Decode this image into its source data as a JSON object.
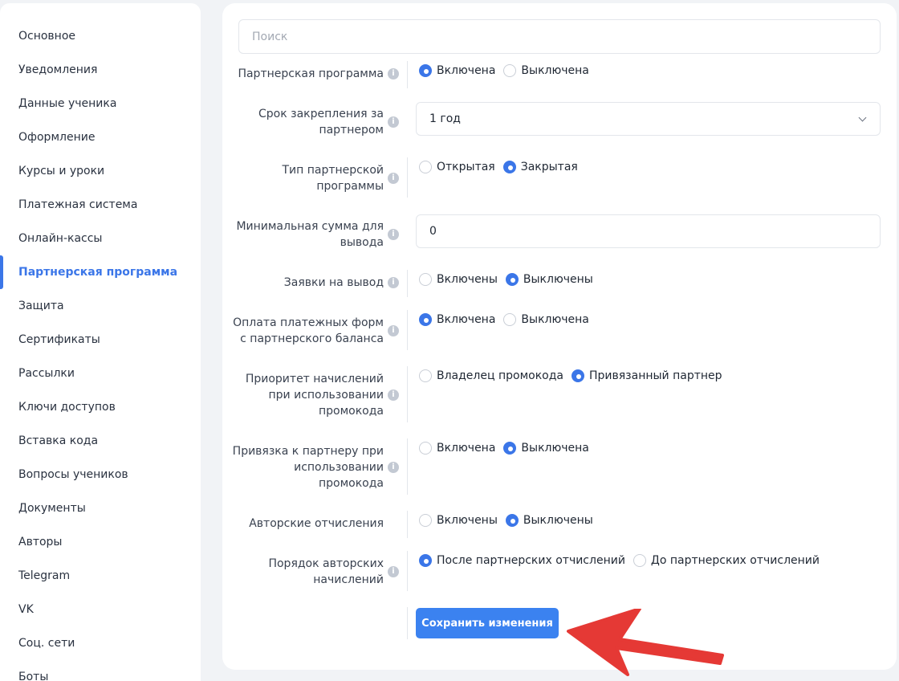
{
  "sidebar": {
    "items": [
      {
        "label": "Основное"
      },
      {
        "label": "Уведомления"
      },
      {
        "label": "Данные ученика"
      },
      {
        "label": "Оформление"
      },
      {
        "label": "Курсы и уроки"
      },
      {
        "label": "Платежная система"
      },
      {
        "label": "Онлайн-кассы"
      },
      {
        "label": "Партнерская программа"
      },
      {
        "label": "Защита"
      },
      {
        "label": "Сертификаты"
      },
      {
        "label": "Рассылки"
      },
      {
        "label": "Ключи доступов"
      },
      {
        "label": "Вставка кода"
      },
      {
        "label": "Вопросы учеников"
      },
      {
        "label": "Документы"
      },
      {
        "label": "Авторы"
      },
      {
        "label": "Telegram"
      },
      {
        "label": "VK"
      },
      {
        "label": "Соц. сети"
      },
      {
        "label": "Боты"
      }
    ],
    "active_item": "Партнерская программа"
  },
  "search": {
    "placeholder": "Поиск"
  },
  "settings": {
    "program": {
      "label": "Партнерская программа",
      "options": [
        "Включена",
        "Выключена"
      ],
      "selected": "Включена"
    },
    "term": {
      "label_line1": "Срок закрепления за",
      "label_line2": "партнером",
      "value": "1 год"
    },
    "type": {
      "label_line1": "Тип партнерской",
      "label_line2": "программы",
      "options": [
        "Открытая",
        "Закрытая"
      ],
      "selected": "Закрытая"
    },
    "min_sum": {
      "label_line1": "Минимальная сумма для",
      "label_line2": "вывода",
      "value": "0"
    },
    "withdraw": {
      "label": "Заявки на вывод",
      "options": [
        "Включены",
        "Выключены"
      ],
      "selected": "Выключены"
    },
    "balance_pay": {
      "label_line1": "Оплата платежных форм",
      "label_line2": "с партнерского баланса",
      "options": [
        "Включена",
        "Выключена"
      ],
      "selected": "Включена"
    },
    "priority": {
      "label_line1": "Приоритет начислений",
      "label_line2": "при использовании",
      "label_line3": "промокода",
      "options": [
        "Владелец промокода",
        "Привязанный партнер"
      ],
      "selected": "Привязанный партнер"
    },
    "binding": {
      "label_line1": "Привязка к партнеру при",
      "label_line2": "использовании",
      "label_line3": "промокода",
      "options": [
        "Включена",
        "Выключена"
      ],
      "selected": "Выключена"
    },
    "author_fees": {
      "label": "Авторские отчисления",
      "options": [
        "Включены",
        "Выключены"
      ],
      "selected": "Выключены"
    },
    "author_order": {
      "label_line1": "Порядок авторских",
      "label_line2": "начислений",
      "options": [
        "После партнерских отчислений",
        "До партнерских отчислений"
      ],
      "selected": "После партнерских отчислений"
    }
  },
  "save_button": {
    "label": "Сохранить изменения"
  },
  "icons": {
    "info": "info-icon",
    "chevron": "chevron-down-icon",
    "arrow": "red-annotation-arrow"
  },
  "colors": {
    "accent": "#3b76e8",
    "button": "#3b82f0",
    "arrow": "#e53935"
  }
}
